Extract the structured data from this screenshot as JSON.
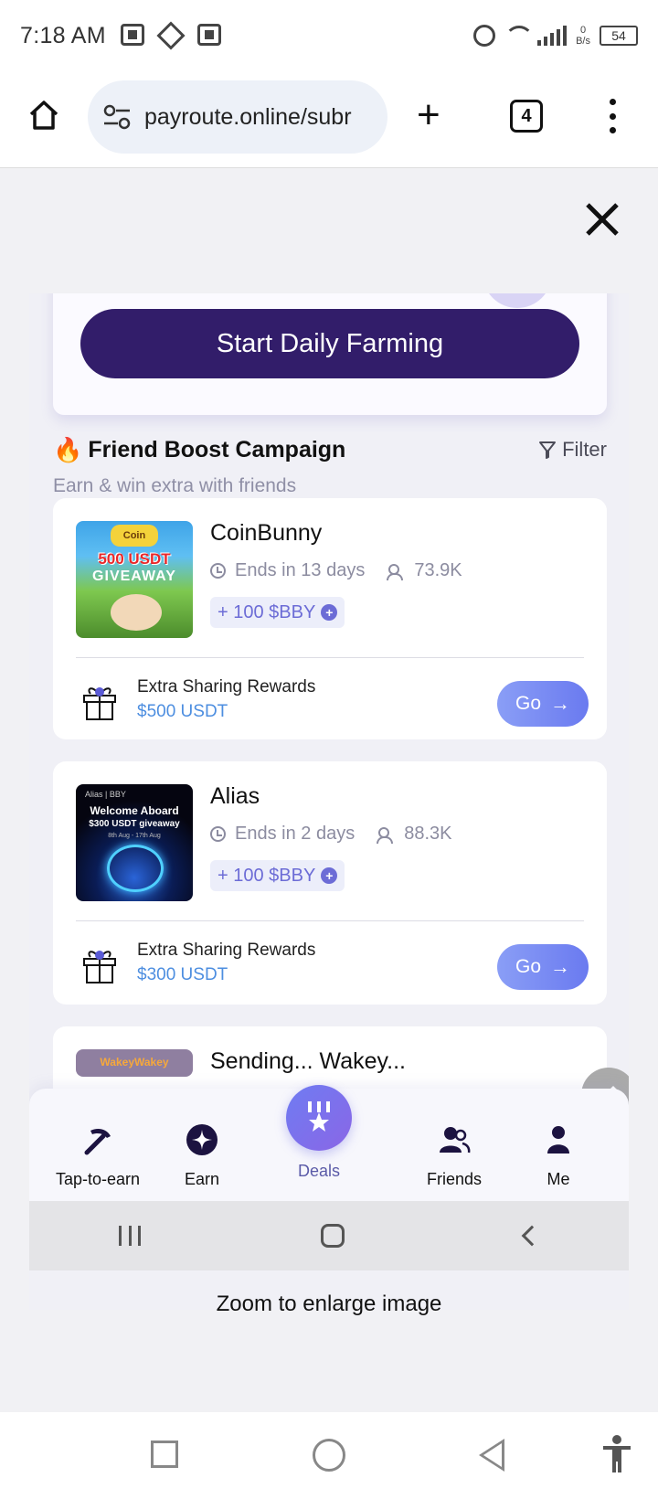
{
  "status_bar": {
    "time": "7:18 AM",
    "net_speed_value": "0",
    "net_speed_unit": "B/s",
    "battery": "54"
  },
  "browser": {
    "url": "payroute.online/subr",
    "tab_count": "4"
  },
  "app": {
    "farm_button": "Start Daily Farming",
    "section_title": "Friend Boost Campaign",
    "section_subtitle": "Earn & win extra with friends",
    "filter_label": "Filter",
    "campaigns": [
      {
        "name": "CoinBunny",
        "ends": "Ends in 13 days",
        "participants": "73.9K",
        "reward": "+ 100 $BBY",
        "extra_label": "Extra Sharing Rewards",
        "extra_value": "$500 USDT",
        "go_label": "Go",
        "thumb_logo": "Coin",
        "thumb_line1": "500 USDT",
        "thumb_line2": "GIVEAWAY"
      },
      {
        "name": "Alias",
        "ends": "Ends in 2 days",
        "participants": "88.3K",
        "reward": "+ 100 $BBY",
        "extra_label": "Extra Sharing Rewards",
        "extra_value": "$300 USDT",
        "go_label": "Go",
        "thumb_brand": "Alias | BBY",
        "thumb_line1": "Welcome Aboard",
        "thumb_line2": "$300 USDT giveaway",
        "thumb_line3": "8th Aug - 17th Aug"
      },
      {
        "name": "Sending... Wakey...",
        "thumb_text": "WakeyWakey"
      }
    ],
    "nav": [
      {
        "label": "Tap-to-earn"
      },
      {
        "label": "Earn"
      },
      {
        "label": "Deals"
      },
      {
        "label": "Friends"
      },
      {
        "label": "Me"
      }
    ]
  },
  "viewer": {
    "caption": "Zoom to enlarge image"
  },
  "colors": {
    "primary_button": "#321d6a",
    "accent_blue": "#4d8ee0",
    "go_button": "#7a8cf3",
    "flame": "#f06a16"
  },
  "icons": [
    "home-icon",
    "tune-icon",
    "plus-icon",
    "tabs-icon",
    "more-vert-icon",
    "close-icon",
    "flame-icon",
    "filter-icon",
    "clock-icon",
    "users-icon",
    "gift-icon",
    "arrow-right-icon",
    "pencil-icon",
    "pickaxe-icon",
    "sparkle-icon",
    "deals-icon",
    "friends-icon",
    "person-icon",
    "accessibility-icon"
  ]
}
